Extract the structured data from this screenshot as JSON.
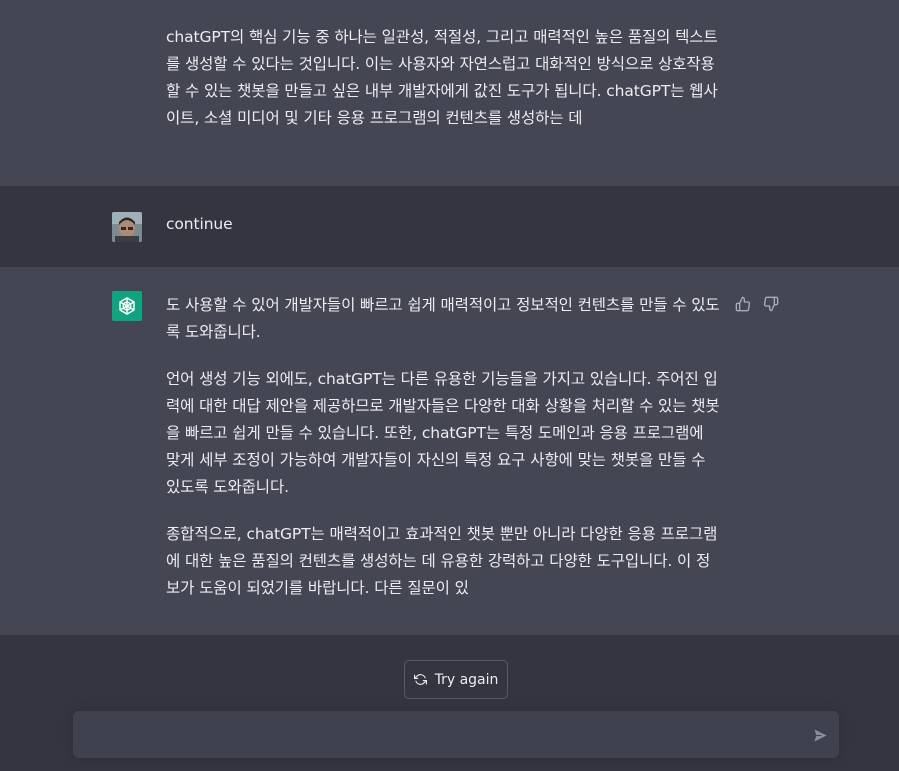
{
  "messages": [
    {
      "role": "assistant",
      "paragraphs": [
        "chatGPT의 핵심 기능 중 하나는 일관성, 적절성, 그리고 매력적인 높은 품질의 텍스트를 생성할 수 있다는 것입니다. 이는 사용자와 자연스럽고 대화적인 방식으로 상호작용할 수 있는 챗봇을 만들고 싶은 내부 개발자에게 값진 도구가 됩니다. chatGPT는 웹사이트, 소셜 미디어 및 기타 응용 프로그램의 컨텐츠를 생성하는 데"
      ]
    },
    {
      "role": "user",
      "paragraphs": [
        "continue"
      ]
    },
    {
      "role": "assistant",
      "paragraphs": [
        "도 사용할 수 있어 개발자들이 빠르고 쉽게 매력적이고 정보적인 컨텐츠를 만들 수 있도록 도와줍니다.",
        "언어 생성 기능 외에도, chatGPT는 다른 유용한 기능들을 가지고 있습니다. 주어진 입력에 대한 대답 제안을 제공하므로 개발자들은 다양한 대화 상황을 처리할 수 있는 챗봇을 빠르고 쉽게 만들 수 있습니다. 또한, chatGPT는 특정 도메인과 응용 프로그램에 맞게 세부 조정이 가능하여 개발자들이 자신의 특정 요구 사항에 맞는 챗봇을 만들 수 있도록 도와줍니다.",
        "종합적으로, chatGPT는 매력적이고 효과적인 챗봇 뿐만 아니라 다양한 응용 프로그램에 대한 높은 품질의 컨텐츠를 생성하는 데 유용한 강력하고 다양한 도구입니다. 이 정보가 도움이 되었기를 바랍니다. 다른 질문이 있"
      ]
    }
  ],
  "controls": {
    "try_again_label": "Try again",
    "composer_placeholder": ""
  },
  "icons": {
    "thumbs_up": "thumbs-up-icon",
    "thumbs_down": "thumbs-down-icon",
    "refresh": "refresh-icon",
    "send": "send-icon",
    "assistant_logo": "openai-logo-icon"
  },
  "colors": {
    "assistant_bg": "#444654",
    "user_bg": "#343541",
    "accent": "#10a37f"
  }
}
